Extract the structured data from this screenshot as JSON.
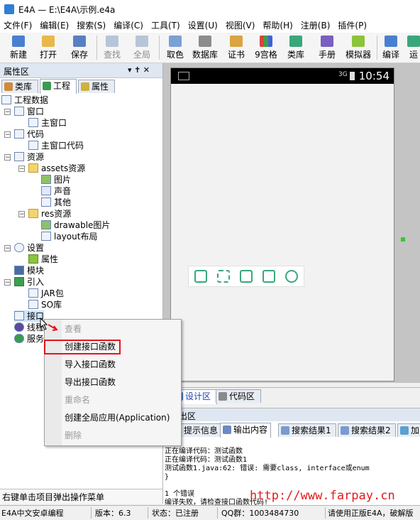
{
  "window": {
    "title": "E4A — E:\\E4A\\示例.e4a"
  },
  "menu": [
    "文件(F)",
    "编辑(E)",
    "搜索(S)",
    "编译(C)",
    "工具(T)",
    "设置(U)",
    "视图(V)",
    "帮助(H)",
    "注册(B)",
    "插件(P)"
  ],
  "toolbar": [
    {
      "label": "新建",
      "icon": "new-file-icon",
      "enabled": true
    },
    {
      "label": "打开",
      "icon": "open-folder-icon",
      "enabled": true
    },
    {
      "label": "保存",
      "icon": "save-icon",
      "enabled": true
    },
    {
      "label": "查找",
      "icon": "find-icon",
      "enabled": false
    },
    {
      "label": "全局",
      "icon": "global-search-icon",
      "enabled": false
    },
    {
      "label": "取色",
      "icon": "color-picker-icon",
      "enabled": true
    },
    {
      "label": "数据库",
      "icon": "database-icon",
      "enabled": true
    },
    {
      "label": "证书",
      "icon": "certificate-icon",
      "enabled": true
    },
    {
      "label": "9宫格",
      "icon": "grid-icon",
      "enabled": true
    },
    {
      "label": "类库",
      "icon": "library-icon",
      "enabled": true
    },
    {
      "label": "手册",
      "icon": "manual-icon",
      "enabled": true
    },
    {
      "label": "模拟器",
      "icon": "android-icon",
      "enabled": true
    },
    {
      "label": "编译",
      "icon": "compile-icon",
      "enabled": true
    },
    {
      "label": "运",
      "icon": "run-icon",
      "enabled": true
    }
  ],
  "left_panel": {
    "title": "属性区",
    "controls": "▾ ✝ ✕",
    "tabs": [
      "类库",
      "工程",
      "属性"
    ],
    "active_tab": "工程",
    "tree": [
      {
        "label": "工程数据",
        "level": 0
      },
      {
        "label": "窗口",
        "level": 1
      },
      {
        "label": "主窗口",
        "level": 2
      },
      {
        "label": "代码",
        "level": 1
      },
      {
        "label": "主窗口代码",
        "level": 2
      },
      {
        "label": "资源",
        "level": 1
      },
      {
        "label": "assets资源",
        "level": 2
      },
      {
        "label": "图片",
        "level": 3
      },
      {
        "label": "声音",
        "level": 3
      },
      {
        "label": "其他",
        "level": 3
      },
      {
        "label": "res资源",
        "level": 2
      },
      {
        "label": "drawable图片",
        "level": 3
      },
      {
        "label": "layout布局",
        "level": 3
      },
      {
        "label": "设置",
        "level": 1
      },
      {
        "label": "属性",
        "level": 2
      },
      {
        "label": "模块",
        "level": 1
      },
      {
        "label": "引入",
        "level": 1
      },
      {
        "label": "JAR包",
        "level": 2
      },
      {
        "label": "SO库",
        "level": 2
      },
      {
        "label": "接口",
        "level": 1
      },
      {
        "label": "线程",
        "level": 1
      },
      {
        "label": "服务",
        "level": 1
      }
    ],
    "status": "右键单击项目弹出操作菜单"
  },
  "design": {
    "time": "10:54",
    "signal": "3G"
  },
  "design_tabs": [
    "设计区",
    "代码区"
  ],
  "output": {
    "title": "出区",
    "tabs": [
      "提示信息",
      "输出内容",
      "搜索结果1",
      "搜索结果2",
      "加"
    ],
    "active_tab": "输出内容",
    "lines": [
      "正在编译代码：测试函数",
      "正在编译代码：测试函数1",
      "测试函数1.java:62: 错误: 需要class, interface或enum",
      "}",
      "",
      "1 个错误",
      "编译失败，请检查接口函数代码!"
    ]
  },
  "context_menu": {
    "items": [
      {
        "label": "查看",
        "enabled": false
      },
      {
        "label": "创建接口函数",
        "enabled": true,
        "highlighted": true
      },
      {
        "label": "导入接口函数",
        "enabled": true
      },
      {
        "label": "导出接口函数",
        "enabled": true
      },
      {
        "label": "重命名",
        "enabled": false
      },
      {
        "label": "创建全局应用(Application)",
        "enabled": true
      },
      {
        "label": "删除",
        "enabled": false
      }
    ]
  },
  "statusbar": [
    "E4A中文安卓编程",
    "版本：6.3",
    "状态：已注册",
    "QQ群：1003484730",
    "请使用正版E4A，破解版"
  ],
  "watermark": "http://www.farpay.cn",
  "colors": {
    "highlight_border": "#e3141b",
    "accent": "#3aa77a",
    "watermark": "#e31a1a"
  }
}
